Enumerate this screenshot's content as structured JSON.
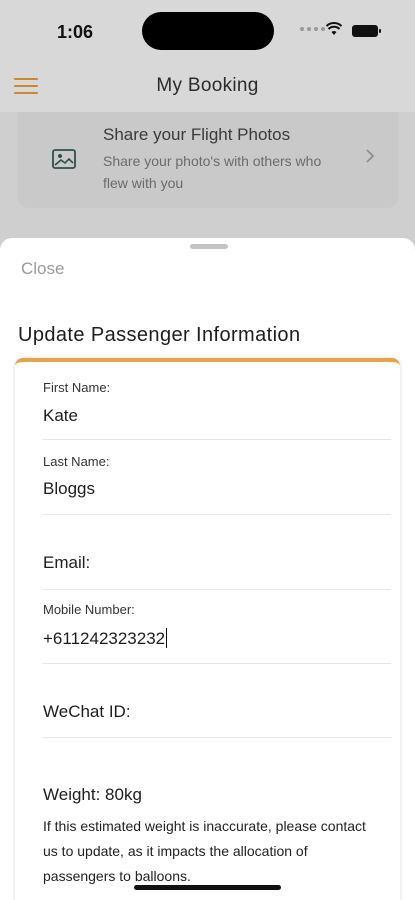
{
  "status": {
    "time": "1:06"
  },
  "header": {
    "title": "My Booking"
  },
  "background_card": {
    "title": "Share your Flight Photos",
    "subtitle": "Share your photo's with others who flew with you"
  },
  "sheet": {
    "close_label": "Close",
    "title": "Update Passenger Information",
    "fields": {
      "first_name": {
        "label": "First Name:",
        "value": "Kate"
      },
      "last_name": {
        "label": "Last Name:",
        "value": "Bloggs"
      },
      "email": {
        "placeholder": "Email:"
      },
      "mobile": {
        "label": "Mobile Number:",
        "value": "+611242323232"
      },
      "wechat": {
        "placeholder": "WeChat ID:"
      }
    },
    "weight": {
      "label": "Weight: 80kg",
      "note": "If this estimated weight is inaccurate, please contact us to update, as it impacts the allocation of passengers to balloons."
    }
  },
  "colors": {
    "accent": "#e8a24a",
    "menu_icon": "#c78a32"
  }
}
